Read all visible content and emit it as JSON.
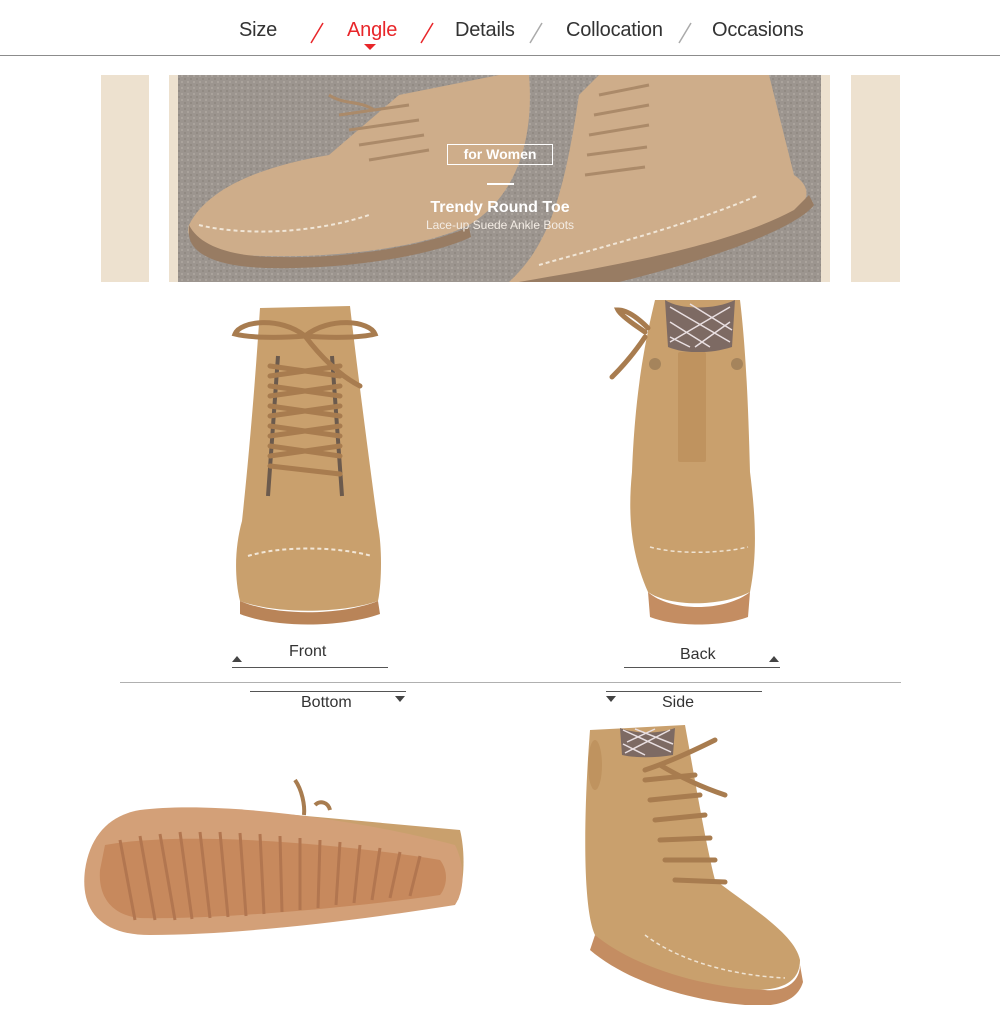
{
  "nav": {
    "items": [
      {
        "label": "Size",
        "active": false
      },
      {
        "label": "Angle",
        "active": true
      },
      {
        "label": "Details",
        "active": false
      },
      {
        "label": "Collocation",
        "active": false
      },
      {
        "label": "Occasions",
        "active": false
      }
    ],
    "accent_color": "#e8262a"
  },
  "banner": {
    "badge": "for Women",
    "title": "Trendy Round Toe",
    "subtitle": "Lace-up Suede Ankle Boots"
  },
  "views": {
    "front": "Front",
    "back": "Back",
    "bottom": "Bottom",
    "side": "Side"
  },
  "colors": {
    "suede": "#c9a06d",
    "sole": "#c48d62",
    "banner_side": "#ede1cf"
  }
}
